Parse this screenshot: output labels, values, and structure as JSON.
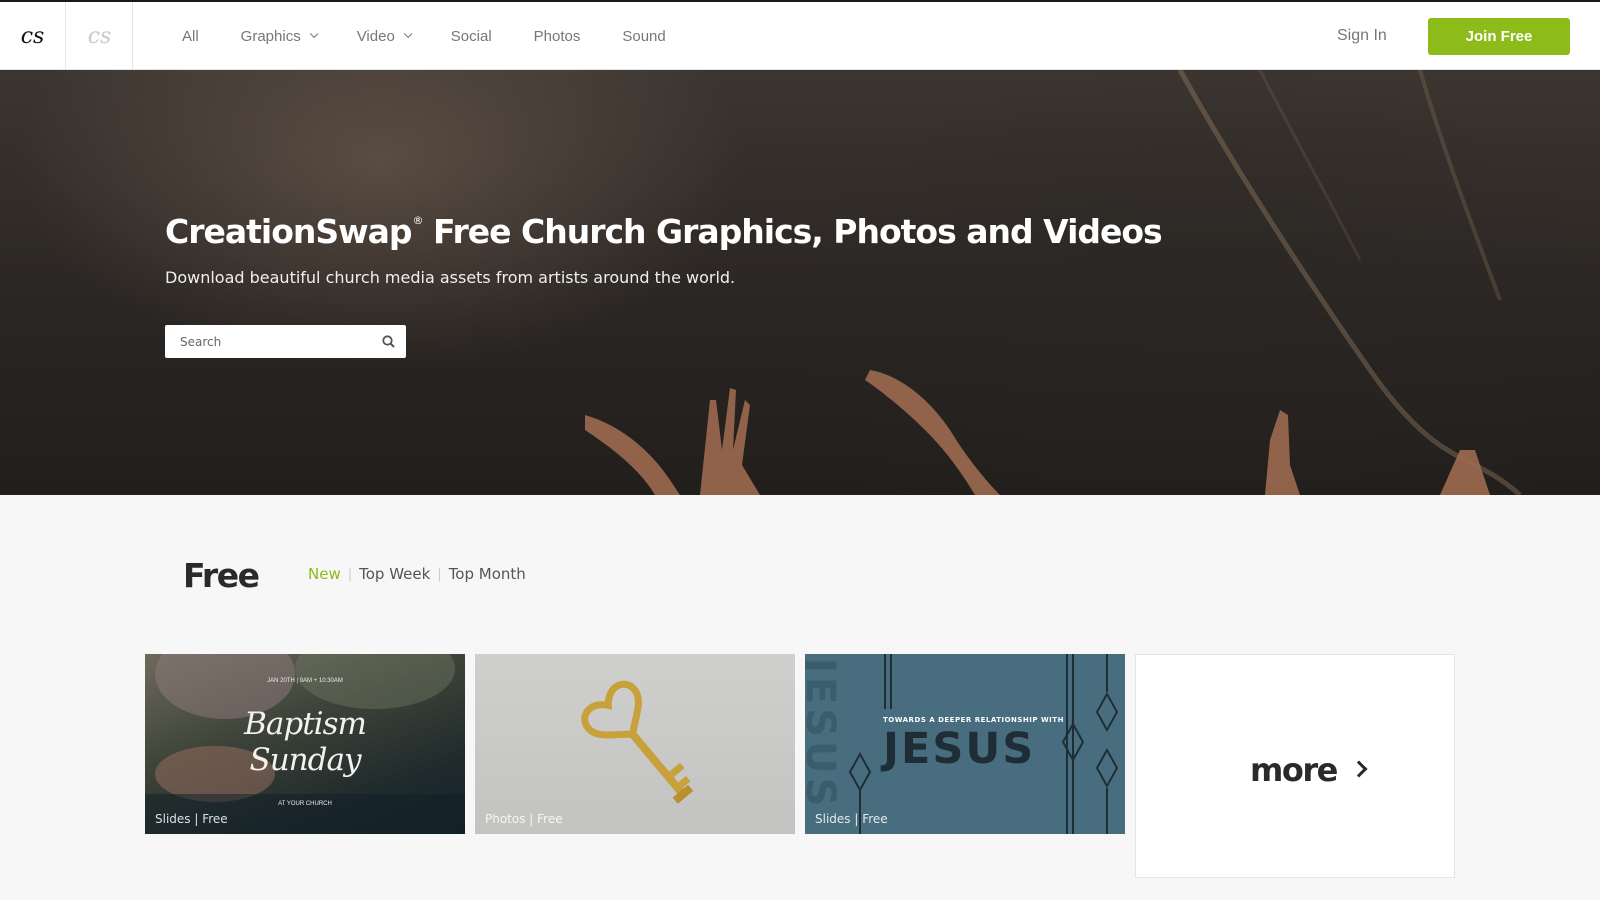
{
  "header": {
    "logo_primary": "cs",
    "logo_secondary": "cs",
    "nav": [
      {
        "label": "All",
        "has_dropdown": false
      },
      {
        "label": "Graphics",
        "has_dropdown": true
      },
      {
        "label": "Video",
        "has_dropdown": true
      },
      {
        "label": "Social",
        "has_dropdown": false
      },
      {
        "label": "Photos",
        "has_dropdown": false
      },
      {
        "label": "Sound",
        "has_dropdown": false
      }
    ],
    "sign_in": "Sign In",
    "join": "Join Free",
    "accent_color": "#8cbb1a"
  },
  "hero": {
    "brand": "CreationSwap",
    "registered_mark": "®",
    "title_rest": "Free Church Graphics, Photos and Videos",
    "subtitle": "Download beautiful church media assets from artists around the world.",
    "search_placeholder": "Search",
    "search_icon": "search-icon"
  },
  "section": {
    "title": "Free",
    "filters": [
      "New",
      "Top Week",
      "Top Month"
    ],
    "active_filter": "New",
    "cards": [
      {
        "meta": "Slides | Free",
        "art_line1": "Baptism",
        "art_line2": "Sunday",
        "art_date": "JAN 20TH | 9AM + 10:30AM",
        "art_footer": "AT YOUR CHURCH"
      },
      {
        "meta": "Photos | Free",
        "art": "golden-heart-key"
      },
      {
        "meta": "Slides | Free",
        "art_small": "TOWARDS A DEEPER RELATIONSHIP WITH",
        "art_big": "JESUS",
        "art_vertical": "JESUS"
      }
    ],
    "more_label": "more"
  }
}
